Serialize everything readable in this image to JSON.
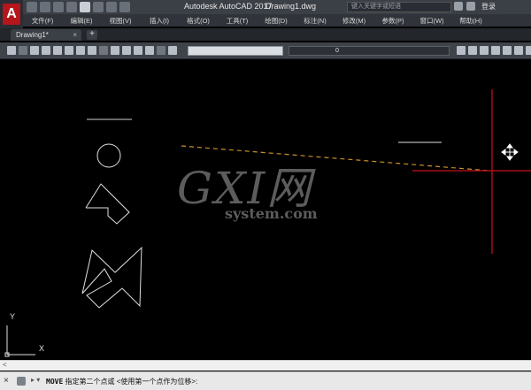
{
  "title": {
    "app": "Autodesk AutoCAD 2017",
    "document": "Drawing1.dwg"
  },
  "search": {
    "placeholder": "键入关键字或短语"
  },
  "login": "登录",
  "menu": [
    "文件(F)",
    "编辑(E)",
    "视图(V)",
    "插入(I)",
    "格式(O)",
    "工具(T)",
    "绘图(D)",
    "标注(N)",
    "修改(M)",
    "参数(P)",
    "窗口(W)",
    "帮助(H)"
  ],
  "tab": {
    "label": "Drawing1*",
    "close": "×",
    "add": "+"
  },
  "layer_combo": {
    "value": "0"
  },
  "watermark": {
    "big": "GXI网",
    "small": "system.com"
  },
  "ucs": {
    "y": "Y",
    "x": "X"
  },
  "command": {
    "name": "MOVE",
    "prompt": "指定第二个点或 <使用第一个点作为位移>:"
  },
  "colors": {
    "crosshair": "#c8101a",
    "rubberband": "#c89028",
    "lines": "#e0e0e0"
  },
  "icons": [
    "autocad-logo-icon",
    "quick-access-icons",
    "move-cursor-icon",
    "ucs-icon",
    "wrench-icon"
  ]
}
